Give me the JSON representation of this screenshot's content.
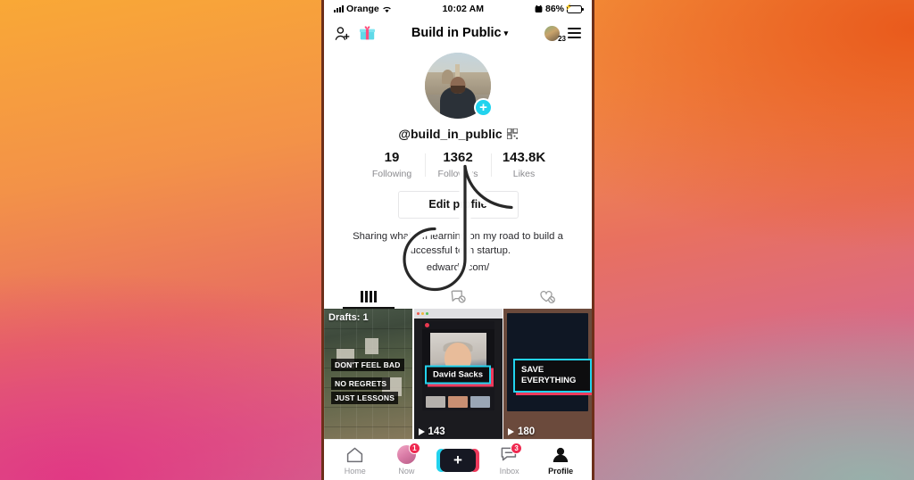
{
  "status_bar": {
    "carrier": "Orange",
    "time": "10:02 AM",
    "battery_percent": "86%",
    "signal_icon": "signal-bars-icon",
    "wifi_icon": "wifi-icon",
    "alarm_icon": "alarm-clock-icon",
    "battery_icon": "battery-charging-icon"
  },
  "header": {
    "title": "Build in Public",
    "chevron": "⌄",
    "add_friends_icon": "add-person-icon",
    "gift_icon": "gift-box-icon",
    "avatar_badge": "23",
    "menu_icon": "hamburger-menu-icon"
  },
  "profile": {
    "username": "@build_in_public",
    "qr_icon": "qr-code-icon",
    "follow_plus": "+",
    "stats": [
      {
        "value": "19",
        "label": "Following"
      },
      {
        "value": "1362",
        "label": "Followers"
      },
      {
        "value": "143.8K",
        "label": "Likes"
      }
    ],
    "edit_button": "Edit profile",
    "bio": "Sharing what I'm learning on my road to build a successful tech startup.",
    "bio_link": "edwards.com/"
  },
  "tabs": [
    {
      "name": "posts",
      "icon": "grid-icon",
      "active": true
    },
    {
      "name": "reposts",
      "icon": "repost-locked-icon",
      "active": false
    },
    {
      "name": "liked",
      "icon": "heart-locked-icon",
      "active": false
    }
  ],
  "videos": [
    {
      "drafts_label": "Drafts: 1",
      "captions": [
        "DON'T FEEL BAD",
        "NO REGRETS",
        "JUST LESSONS"
      ],
      "plays": ""
    },
    {
      "title": "David Sacks",
      "plays": "143"
    },
    {
      "title": "SAVE EVERYTHING",
      "plays": "180"
    }
  ],
  "watermark": {
    "icon": "tiktok-note-logo"
  },
  "bottom_nav": [
    {
      "label": "Home",
      "icon": "home-icon",
      "badge": "",
      "active": false
    },
    {
      "label": "Now",
      "icon": "now-avatar-icon",
      "badge": "1",
      "active": false
    },
    {
      "label": "",
      "icon": "create-plus-button",
      "badge": "",
      "active": false
    },
    {
      "label": "Inbox",
      "icon": "inbox-message-icon",
      "badge": "3",
      "active": false
    },
    {
      "label": "Profile",
      "icon": "person-icon",
      "badge": "",
      "active": true
    }
  ],
  "colors": {
    "accent_cyan": "#22d3ee",
    "accent_red": "#ee3a5c",
    "badge_red": "#ef2950",
    "text_primary": "#111111",
    "text_muted": "#8b8b8f"
  }
}
